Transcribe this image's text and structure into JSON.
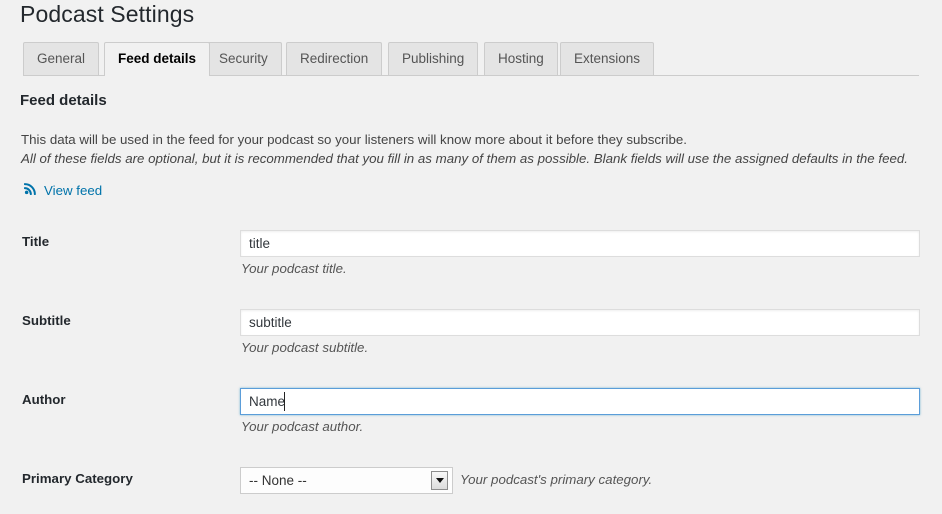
{
  "page": {
    "title": "Podcast Settings"
  },
  "tabs": [
    {
      "label": "General",
      "active": false
    },
    {
      "label": "Feed details",
      "active": true
    },
    {
      "label": "Security",
      "active": false
    },
    {
      "label": "Redirection",
      "active": false
    },
    {
      "label": "Publishing",
      "active": false
    },
    {
      "label": "Hosting",
      "active": false
    },
    {
      "label": "Extensions",
      "active": false
    }
  ],
  "section": {
    "heading": "Feed details",
    "description_line1": "This data will be used in the feed for your podcast so your listeners will know more about it before they subscribe.",
    "description_line2": "All of these fields are optional, but it is recommended that you fill in as many of them as possible. Blank fields will use the assigned defaults in the feed."
  },
  "view_feed": {
    "label": "View feed",
    "icon": "rss-icon",
    "color": "#0073aa"
  },
  "fields": {
    "title": {
      "label": "Title",
      "value": "title",
      "placeholder": "",
      "helper": "Your podcast title."
    },
    "subtitle": {
      "label": "Subtitle",
      "value": "subtitle",
      "placeholder": "",
      "helper": "Your podcast subtitle."
    },
    "author": {
      "label": "Author",
      "value": "Name",
      "placeholder": "",
      "helper": "Your podcast author.",
      "focused": true
    },
    "primary_category": {
      "label": "Primary Category",
      "value": "-- None --",
      "helper": "Your podcast's primary category.",
      "options": [
        "-- None --"
      ]
    }
  },
  "colors": {
    "background": "#f1f1f1",
    "tab_inactive": "#e4e4e4",
    "border": "#cccccc",
    "link": "#0073aa",
    "focus_border": "#5b9dd9",
    "heading": "#23282d"
  }
}
